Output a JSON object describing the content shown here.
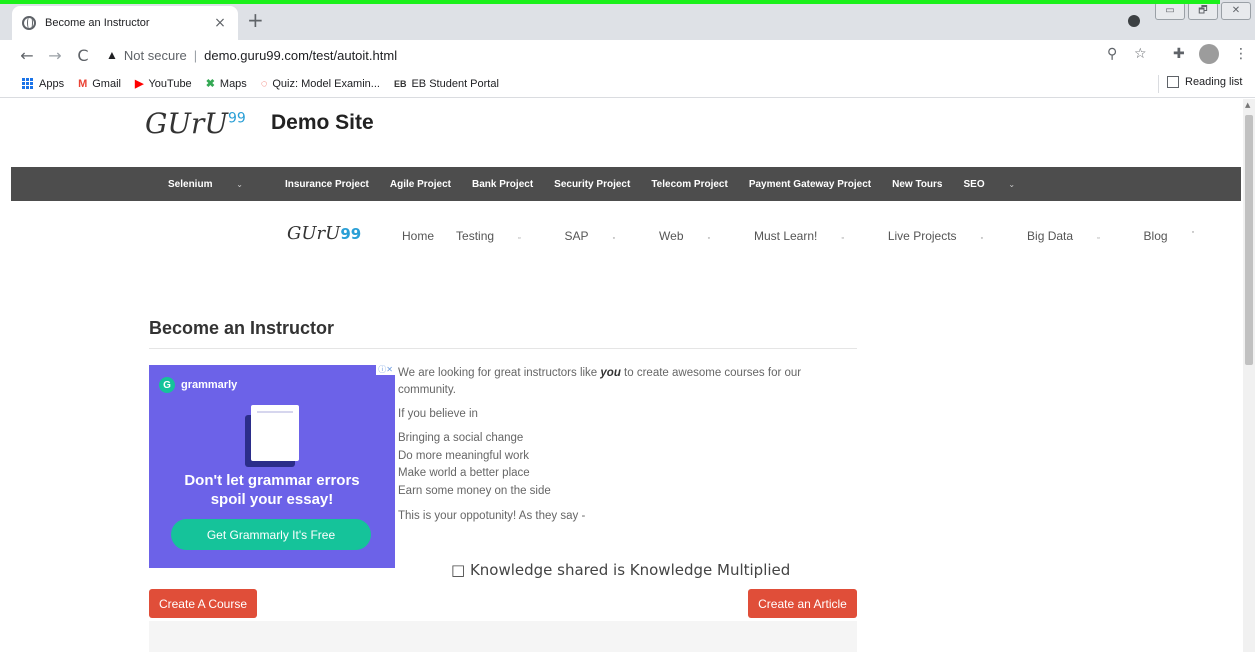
{
  "browser": {
    "tab_title": "Become an Instructor",
    "tab_close": "×",
    "new_tab": "+",
    "security_label": "Not secure",
    "separator": "|",
    "url": "demo.guru99.com/test/autoit.html",
    "window_controls": [
      "▭",
      "🗗",
      "✕"
    ]
  },
  "bookmarks": {
    "items": [
      {
        "label": "Apps",
        "icon": "apps-grid-icon"
      },
      {
        "label": "Gmail",
        "icon": "gmail-icon",
        "glyph": "M",
        "color": "#ea4335"
      },
      {
        "label": "YouTube",
        "icon": "youtube-icon",
        "glyph": "▶",
        "color": "#ff0000"
      },
      {
        "label": "Maps",
        "icon": "maps-icon",
        "glyph": "✖",
        "color": "#34a853"
      },
      {
        "label": "Quiz: Model Examin...",
        "icon": "quiz-icon",
        "glyph": "◌",
        "color": "#ea4335"
      },
      {
        "label": "EB Student Portal",
        "icon": "eb-portal-icon",
        "glyph": "EB",
        "color": "#333333"
      }
    ],
    "reading_list": "Reading list"
  },
  "site": {
    "logo_text": "GUrU",
    "logo_sup": "99",
    "site_title": "Demo Site",
    "top_nav": [
      {
        "label": "Selenium",
        "caret": true
      },
      {
        "label": "Insurance Project",
        "caret": false
      },
      {
        "label": "Agile Project",
        "caret": false
      },
      {
        "label": "Bank Project",
        "caret": false
      },
      {
        "label": "Security Project",
        "caret": false
      },
      {
        "label": "Telecom Project",
        "caret": false
      },
      {
        "label": "Payment Gateway Project",
        "caret": false
      },
      {
        "label": "New Tours",
        "caret": false
      },
      {
        "label": "SEO",
        "caret": true
      }
    ],
    "menu_logo": "GUrU",
    "menu_logo_num": "99",
    "menu": [
      {
        "label": "Home",
        "dropdown": false
      },
      {
        "label": "Testing",
        "dropdown": true
      },
      {
        "label": "SAP",
        "dropdown": true
      },
      {
        "label": "Web",
        "dropdown": true
      },
      {
        "label": "Must Learn!",
        "dropdown": true
      },
      {
        "label": "Live Projects",
        "dropdown": true
      },
      {
        "label": "Big Data",
        "dropdown": true
      },
      {
        "label": "Blog",
        "dropdown": false
      }
    ]
  },
  "content": {
    "page_title": "Become an Instructor",
    "intro_pre": "We are looking for great instructors like ",
    "intro_em": "you",
    "intro_post": " to create awesome courses for our community.",
    "believe": "If you believe in",
    "list": [
      "Bringing a social change",
      "Do more meaningful work",
      "Make world a better place",
      "Earn some money on the side"
    ],
    "opportunity": "This is your oppotunity! As they say -",
    "quote": "□ Knowledge shared is Knowledge Multiplied",
    "create_course": "Create A Course",
    "create_article": "Create an Article"
  },
  "ad": {
    "brand": "grammarly",
    "brand_glyph": "G",
    "headline_line1": "Don't let grammar errors",
    "headline_line2": "spoil your essay!",
    "cta": "Get Grammarly  It's Free",
    "corner": "ⓘ✕",
    "bg_color": "#6c62e8",
    "accent_color": "#15c39a"
  }
}
